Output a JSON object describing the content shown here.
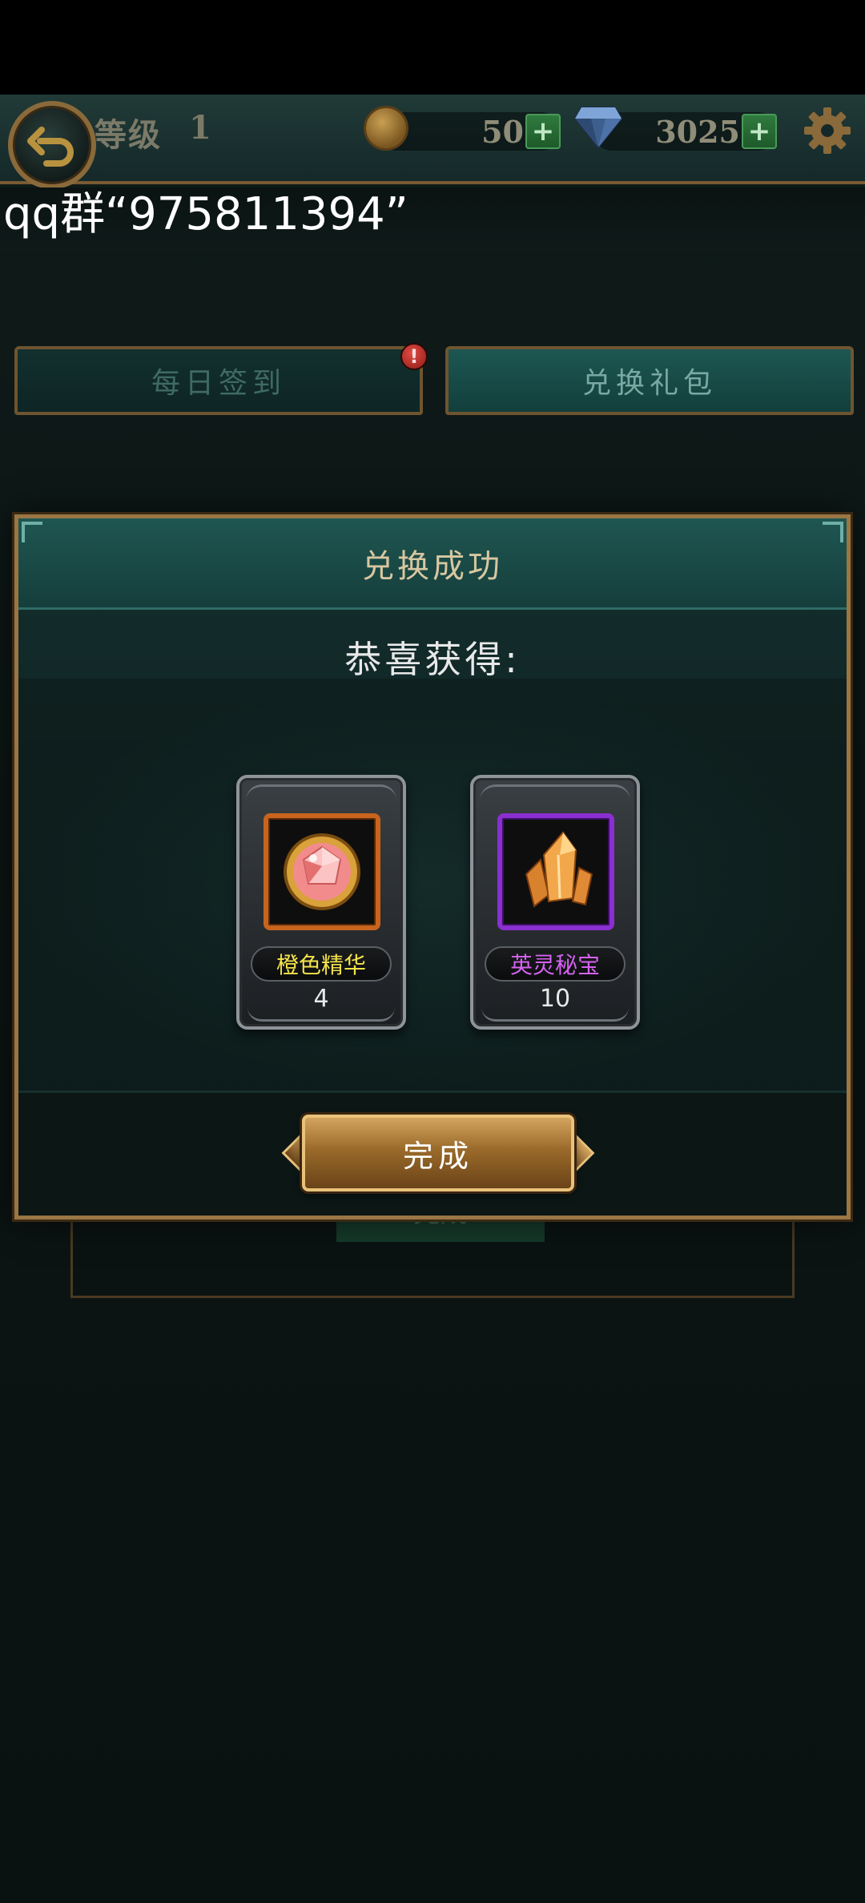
{
  "hud": {
    "level_label": "等级",
    "level_value": "1",
    "coins": "50",
    "diamonds": "3025",
    "plus": "+"
  },
  "overlay": {
    "text": "qq群“975811394”"
  },
  "tabs": {
    "daily": "每日签到",
    "exchange": "兑换礼包",
    "alert": "!"
  },
  "modal": {
    "title": "兑换成功",
    "message": "恭喜获得:",
    "rewards": [
      {
        "name": "橙色精华",
        "quantity": "4",
        "rarity": "orange",
        "icon": "gem-orb-icon"
      },
      {
        "name": "英灵秘宝",
        "quantity": "10",
        "rarity": "purple",
        "icon": "crystal-icon"
      }
    ],
    "done_label": "完成"
  },
  "background": {
    "done_label": "完成"
  },
  "colors": {
    "gold_border": "#9a7645",
    "teal_header": "#1f5652",
    "orange_rarity": "#c8641e",
    "purple_rarity": "#8a2fd0",
    "name_orange": "#f2e24a",
    "name_purple": "#d462f0"
  }
}
